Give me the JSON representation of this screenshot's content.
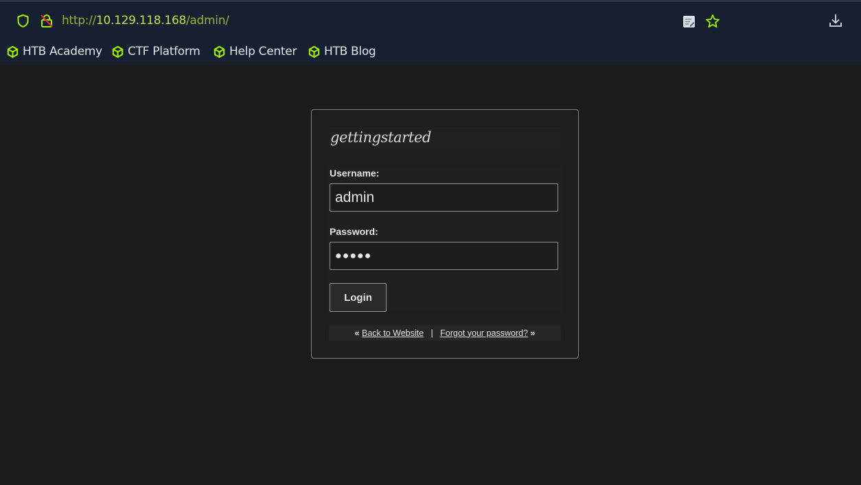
{
  "browser": {
    "url": {
      "scheme": "http://",
      "host": "10.129.118.168",
      "path": "/admin/"
    },
    "bookmarks": [
      {
        "label": "HTB Academy"
      },
      {
        "label": "CTF Platform"
      },
      {
        "label": "Help Center"
      },
      {
        "label": "HTB Blog"
      }
    ],
    "icons": {
      "shield": "shield-icon",
      "insecure_lock": "insecure-lock-icon",
      "reader": "reader-view-icon",
      "bookmark_star": "star-icon",
      "download": "download-icon",
      "bookmark_cube": "cube-icon"
    },
    "accent_color": "#9fef00"
  },
  "login": {
    "site_title": "gettingstarted",
    "username_label": "Username:",
    "username_value": "admin",
    "password_label": "Password:",
    "password_masked": "●●●●●",
    "submit_label": "Login",
    "links": {
      "prefix": "«",
      "back": "Back to Website",
      "separator": "|",
      "forgot": "Forgot your password?",
      "suffix": "»"
    }
  }
}
